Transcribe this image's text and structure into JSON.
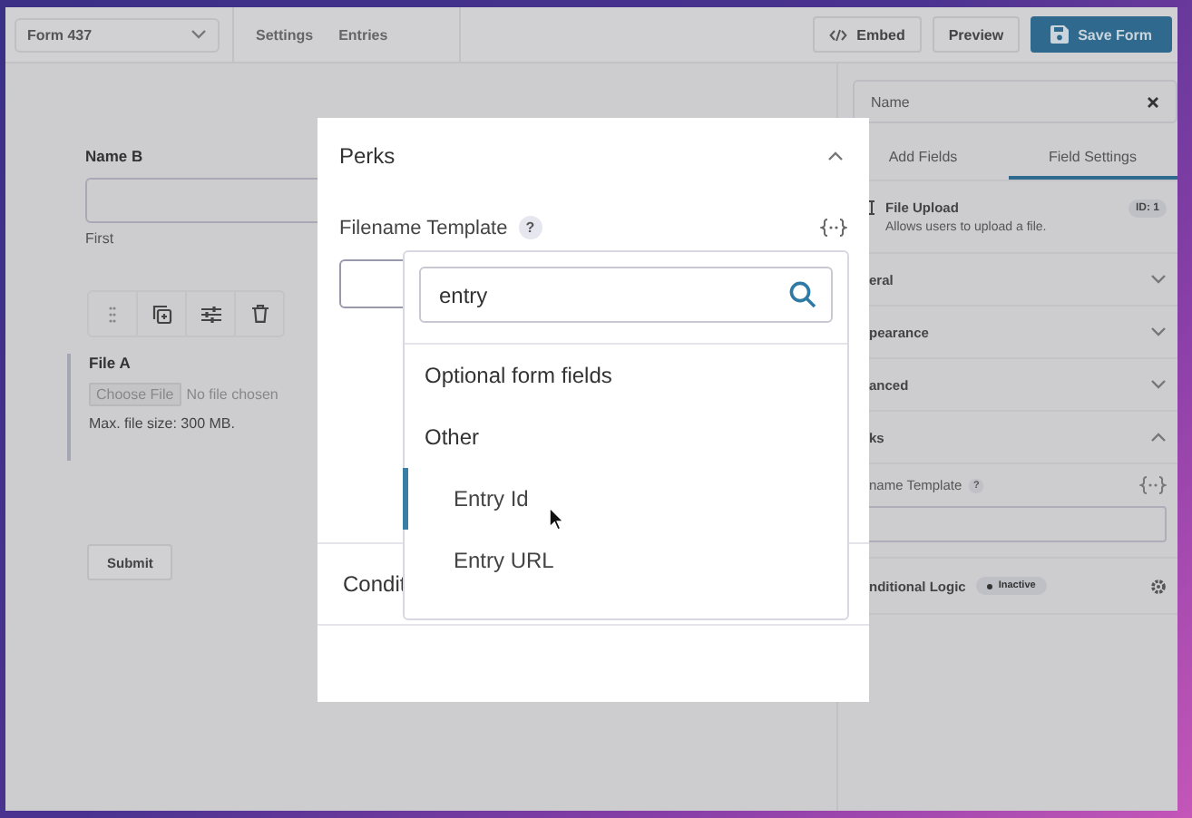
{
  "top_bar": {
    "form_select": "Form 437",
    "nav": [
      {
        "label": "Settings"
      },
      {
        "label": "Entries"
      }
    ],
    "buttons": [
      {
        "label": "Embed",
        "kind": "embed"
      },
      {
        "label": "Preview",
        "kind": "plain"
      },
      {
        "label": "Save Form",
        "kind": "primary"
      }
    ]
  },
  "form": {
    "name_field": {
      "label": "Name B",
      "sublabel": "First"
    },
    "file_field": {
      "label": "File A",
      "button": "Choose File",
      "status": "No file chosen",
      "hint": "Max. file size: 300 MB.",
      "selected": true
    },
    "submit": "Submit"
  },
  "sidebar": {
    "search_value": "Name",
    "tabs": [
      {
        "label": "Add Fields",
        "selected": false
      },
      {
        "label": "Field Settings",
        "selected": true
      }
    ],
    "field_type": {
      "title": "File Upload",
      "description": "Allows users to upload a file.",
      "id_badge": "ID: 1"
    },
    "sections": [
      {
        "title": "eral",
        "expanded": false
      },
      {
        "title": "pearance",
        "expanded": false
      },
      {
        "title": "anced",
        "expanded": false
      },
      {
        "title": "ks",
        "expanded": true
      }
    ],
    "setting": {
      "label": "name Template",
      "help": "?"
    },
    "conditional_logic": {
      "label": "nditional Logic",
      "status": "Inactive"
    }
  },
  "modal": {
    "title": "Perks",
    "expanded": true,
    "setting_label": "Filename Template",
    "help": "?",
    "conditional_label": "Condit"
  },
  "merge_tag_menu": {
    "search_value": "entry",
    "groups": [
      {
        "title": "Optional form fields"
      },
      {
        "title": "Other",
        "items": [
          {
            "label": "Entry Id",
            "selected": true
          },
          {
            "label": "Entry URL",
            "selected": false
          }
        ]
      }
    ]
  }
}
